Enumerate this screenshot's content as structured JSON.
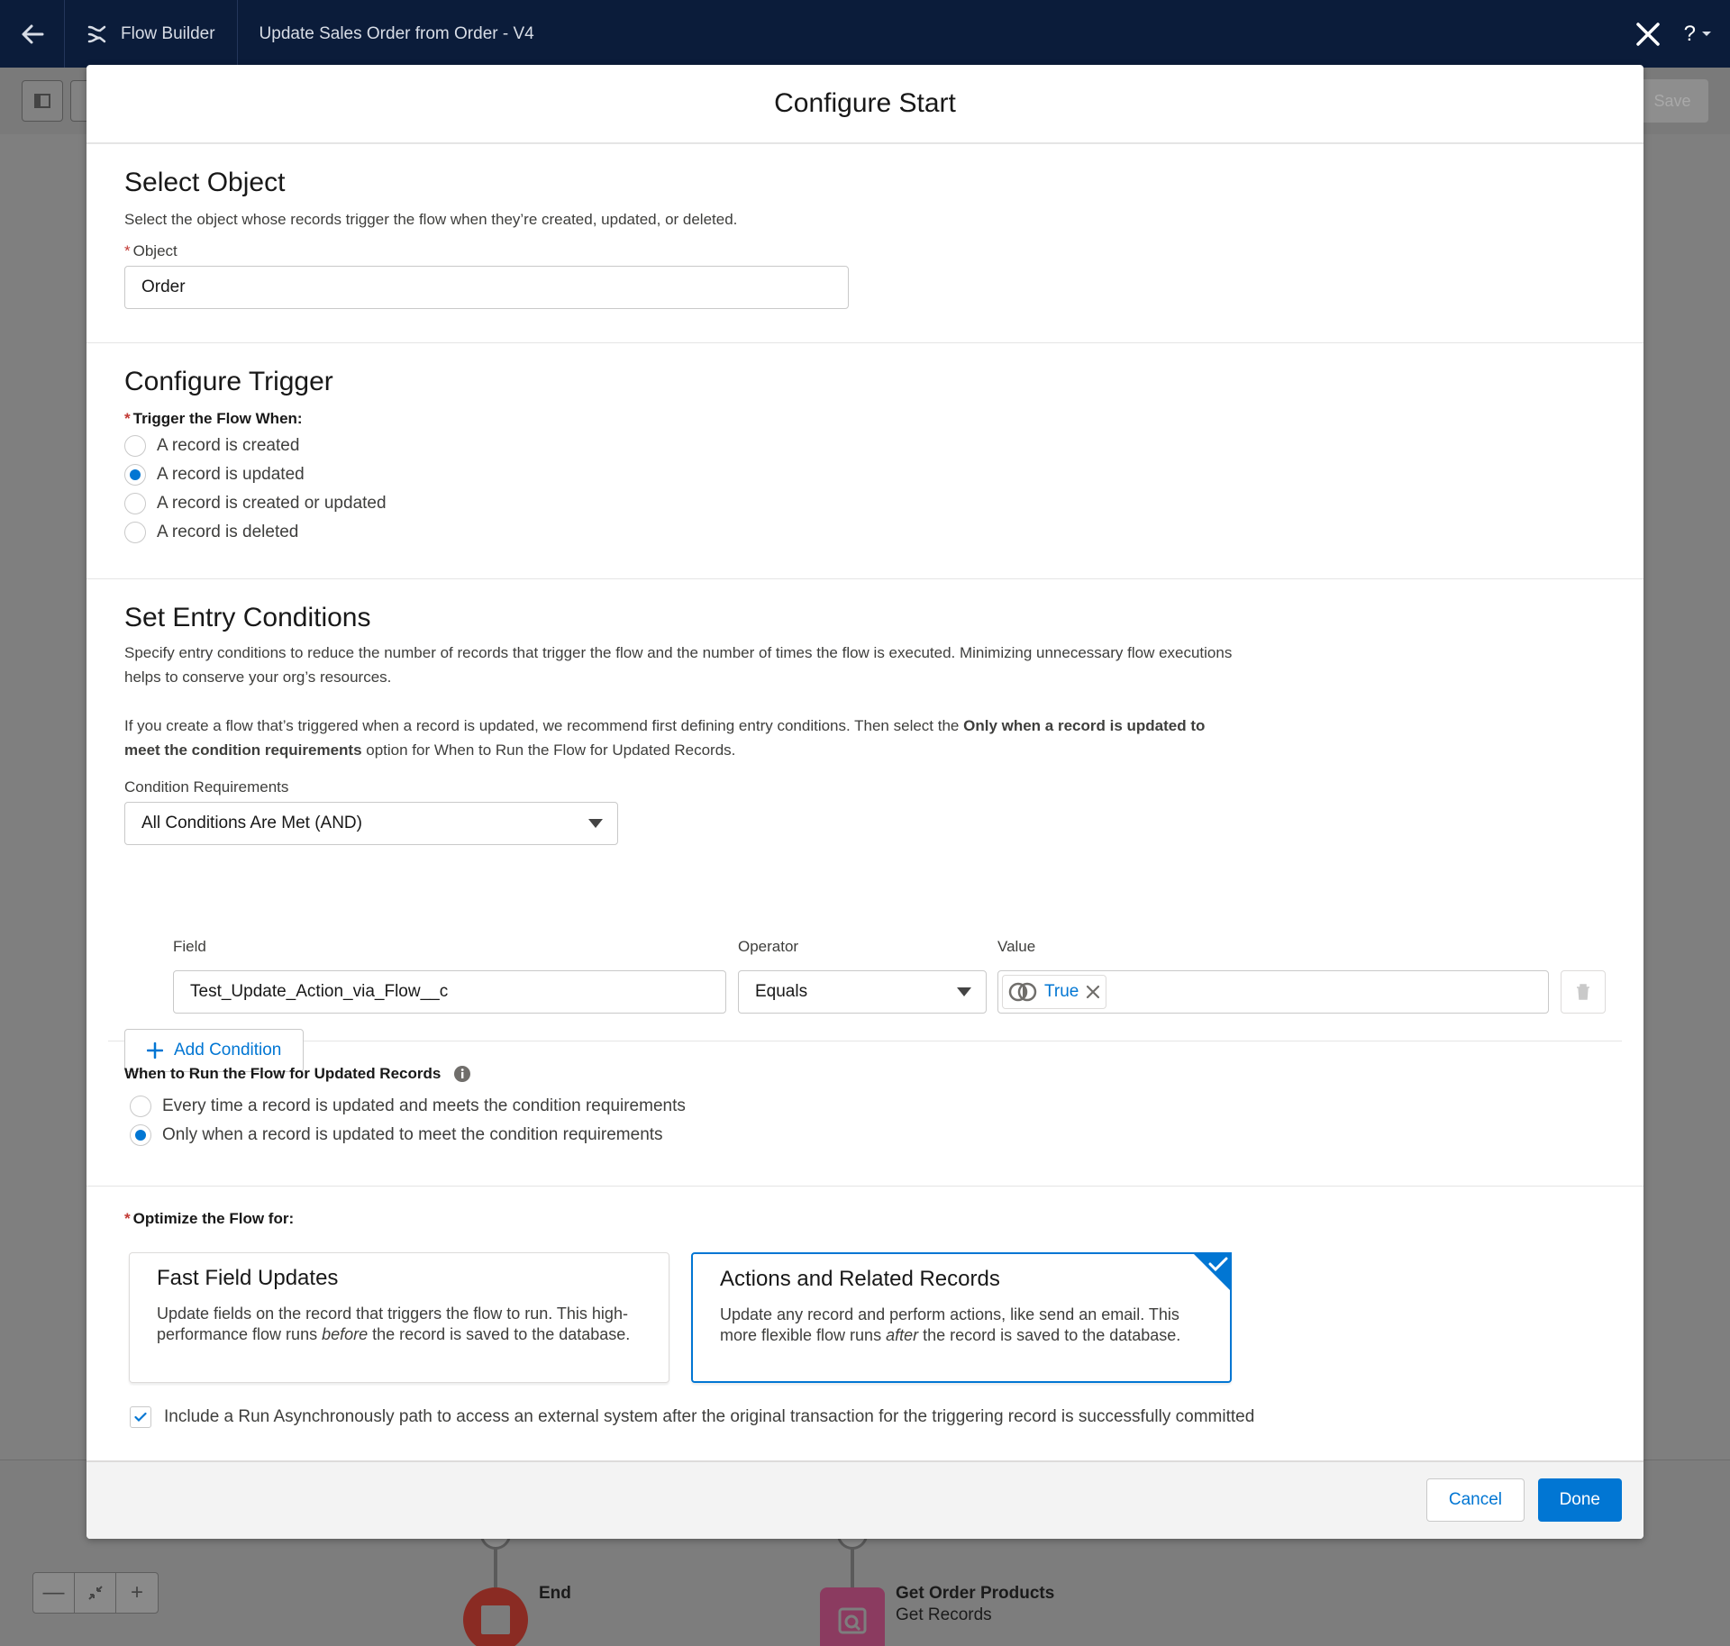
{
  "topbar": {
    "app_name": "Flow Builder",
    "flow_title": "Update Sales Order from Order - V4",
    "help_label": "?"
  },
  "toolbar": {
    "save_label": "Save"
  },
  "canvas": {
    "end_label": "End",
    "get_title": "Get Order Products",
    "get_subtitle": "Get Records"
  },
  "modal": {
    "title": "Configure Start",
    "select_object": {
      "heading": "Select Object",
      "description": "Select the object whose records trigger the flow when they’re created, updated, or deleted.",
      "object_label": "Object",
      "object_value": "Order"
    },
    "trigger": {
      "heading": "Configure Trigger",
      "label": "Trigger the Flow When:",
      "options": [
        {
          "label": "A record is created",
          "selected": false
        },
        {
          "label": "A record is updated",
          "selected": true
        },
        {
          "label": "A record is created or updated",
          "selected": false
        },
        {
          "label": "A record is deleted",
          "selected": false
        }
      ]
    },
    "entry": {
      "heading": "Set Entry Conditions",
      "desc1": "Specify entry conditions to reduce the number of records that trigger the flow and the number of times the flow is executed. Minimizing unnecessary flow executions helps to conserve your org’s resources.",
      "desc2_pre": "If you create a flow that’s triggered when a record is updated, we recommend first defining entry conditions. Then select the ",
      "desc2_bold": "Only when a record is updated to meet the condition requirements",
      "desc2_post": " option for When to Run the Flow for Updated Records.",
      "req_label": "Condition Requirements",
      "req_value": "All Conditions Are Met (AND)",
      "field_label": "Field",
      "field_value": "Test_Update_Action_via_Flow__c",
      "operator_label": "Operator",
      "operator_value": "Equals",
      "value_label": "Value",
      "value_pill": "True",
      "add_condition": "Add Condition"
    },
    "when_run": {
      "label": "When to Run the Flow for Updated Records",
      "options": [
        {
          "label": "Every time a record is updated and meets the condition requirements",
          "selected": false
        },
        {
          "label": "Only when a record is updated to meet the condition requirements",
          "selected": true
        }
      ]
    },
    "optimize": {
      "label": "Optimize the Flow for:",
      "fast": {
        "title": "Fast Field Updates",
        "desc_pre": "Update fields on the record that triggers the flow to run. This high-performance flow runs ",
        "desc_em": "before",
        "desc_post": " the record is saved to the database."
      },
      "actions": {
        "title": "Actions and Related Records",
        "desc_pre": "Update any record and perform actions, like send an email. This more flexible flow runs ",
        "desc_em": "after",
        "desc_post": " the record is saved to the database."
      },
      "async_label": "Include a Run Asynchronously path to access an external system after the original transaction for the triggering record is successfully committed"
    },
    "footer": {
      "cancel": "Cancel",
      "done": "Done"
    }
  },
  "colors": {
    "brand": "#0176d3",
    "nav": "#0b1c3a",
    "required": "#c23934"
  }
}
